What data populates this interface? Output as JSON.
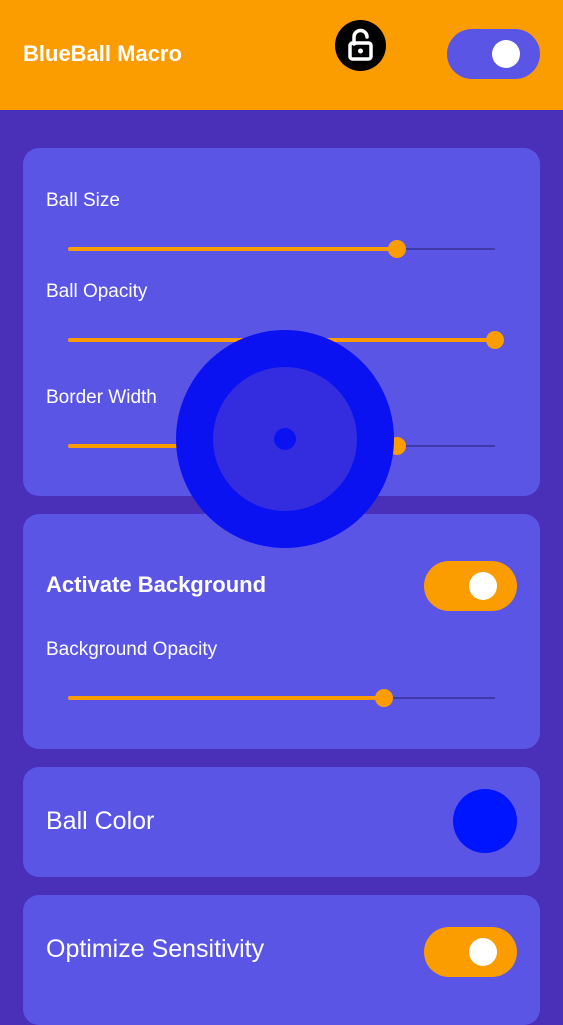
{
  "appbar": {
    "title": "BlueBall Macro",
    "lock_icon": "unlock-icon",
    "main_toggle": {
      "on": true
    }
  },
  "size_card": {
    "sliders": [
      {
        "label": "Ball Size",
        "value": 0.77
      },
      {
        "label": "Ball Opacity",
        "value": 1.0
      },
      {
        "label": "Border Width",
        "value": 0.77
      }
    ]
  },
  "background_card": {
    "title": "Activate Background",
    "toggle": {
      "on": true
    },
    "slider": {
      "label": "Background Opacity",
      "value": 0.74
    }
  },
  "color_card": {
    "label": "Ball Color",
    "color": "#0015ff"
  },
  "sensitivity_card": {
    "label": "Optimize Sensitivity",
    "toggle": {
      "on": true
    }
  },
  "colors": {
    "accent": "#fb9d00",
    "background": "#4a2fb8",
    "card": "#5b55e6",
    "ball": "#0a12f2"
  }
}
